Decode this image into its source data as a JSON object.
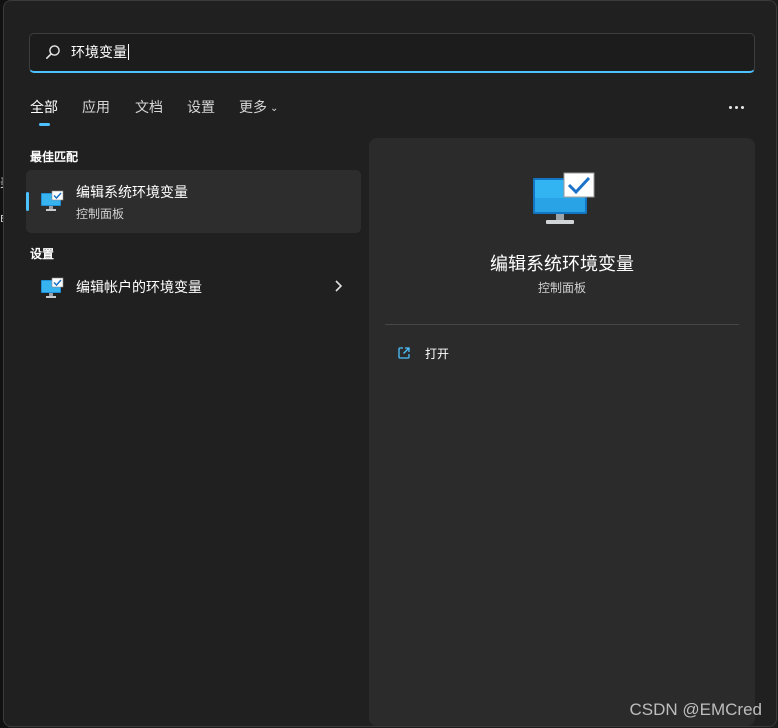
{
  "search": {
    "query": "环境变量"
  },
  "tabs": [
    {
      "label": "全部"
    },
    {
      "label": "应用"
    },
    {
      "label": "文档"
    },
    {
      "label": "设置"
    },
    {
      "label": "更多"
    }
  ],
  "best_match": {
    "section_title": "最佳匹配",
    "title": "编辑系统环境变量",
    "subtitle": "控制面板"
  },
  "settings": {
    "section_title": "设置",
    "item_title": "编辑帐户的环境变量"
  },
  "preview": {
    "title": "编辑系统环境变量",
    "subtitle": "控制面板",
    "action_label": "打开"
  },
  "watermark": "CSDN @EMCred",
  "background_marks": [
    "美",
    "E"
  ],
  "colors": {
    "accent": "#4cc2ff",
    "panel": "#202020",
    "preview": "#2b2b2b",
    "selected_item": "#2d2d2d"
  }
}
